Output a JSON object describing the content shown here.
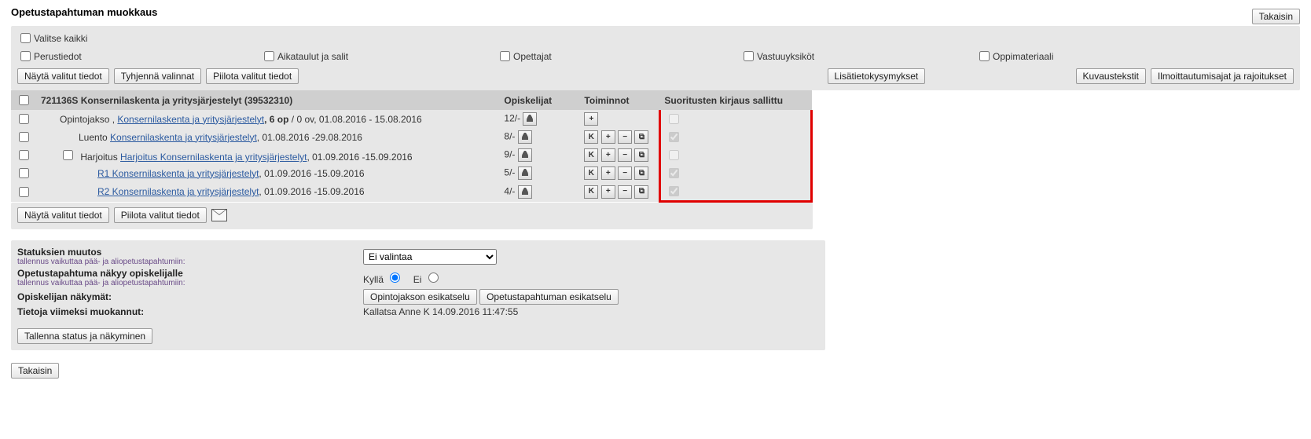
{
  "header": {
    "title": "Opetustapahtuman muokkaus",
    "back_btn": "Takaisin"
  },
  "filter_panel": {
    "select_all": "Valitse kaikki",
    "perustiedot": "Perustiedot",
    "aikataulut": "Aikataulut ja salit",
    "opettajat": "Opettajat",
    "vastuuyksikot": "Vastuuyksiköt",
    "oppimateriaali": "Oppimateriaali",
    "btn_show": "Näytä valitut tiedot",
    "btn_clear": "Tyhjennä valinnat",
    "btn_hide": "Piilota valitut tiedot",
    "btn_lisatieto": "Lisätietokysymykset",
    "btn_kuvaus": "Kuvaustekstit",
    "btn_ilmo": "Ilmoittautumisajat ja rajoitukset"
  },
  "table": {
    "head": {
      "name": "721136S Konsernilaskenta ja yritysjärjestelyt (39532310)",
      "opiskelijat": "Opiskelijat",
      "toiminnot": "Toiminnot",
      "suoritukset": "Suoritusten kirjaus sallittu"
    },
    "rows": [
      {
        "prefix": "Opintojakso , ",
        "link": "Konsernilaskenta ja yritysjärjestelyt",
        "suffix_bold": ", 6 op",
        "suffix": " / 0 ov, 01.08.2016 - 15.08.2016",
        "students": "12/-",
        "actions": "plus",
        "checked": false,
        "disabled": true
      },
      {
        "prefix": "Luento ",
        "link": "Konsernilaskenta ja yritysjärjestelyt",
        "suffix": ", 01.08.2016 -29.08.2016",
        "students": "8/-",
        "actions": "full",
        "checked": true,
        "disabled": true
      },
      {
        "prefix": "Harjoitus ",
        "link": "Harjoitus Konsernilaskenta ja yritysjärjestelyt",
        "suffix": ", 01.09.2016 -15.09.2016",
        "students": "9/-",
        "actions": "full",
        "checked": false,
        "disabled": true
      },
      {
        "prefix": "",
        "link": "R1 Konsernilaskenta ja yritysjärjestelyt",
        "suffix": ", 01.09.2016 -15.09.2016",
        "students": "5/-",
        "actions": "full",
        "checked": true,
        "disabled": true
      },
      {
        "prefix": "",
        "link": "R2 Konsernilaskenta ja yritysjärjestelyt",
        "suffix": ", 01.09.2016 -15.09.2016",
        "students": "4/-",
        "actions": "full",
        "checked": true,
        "disabled": true
      }
    ],
    "btn_show": "Näytä valitut tiedot",
    "btn_hide": "Piilota valitut tiedot"
  },
  "form": {
    "status_label": "Statuksien muutos",
    "status_sub": "tallennus vaikuttaa pää- ja aliopetustapahtumiin:",
    "status_select": "Ei valintaa",
    "visibility_label": "Opetustapahtuma näkyy opiskelijalle",
    "visibility_sub": "tallennus vaikuttaa pää- ja aliopetustapahtumiin:",
    "radio_yes": "Kyllä",
    "radio_no": "Ei",
    "views_label": "Opiskelijan näkymät:",
    "btn_preview_course": "Opintojakson esikatselu",
    "btn_preview_event": "Opetustapahtuman esikatselu",
    "lastedit_label": "Tietoja viimeksi muokannut:",
    "lastedit_value": "Kallatsa Anne K 14.09.2016 11:47:55",
    "btn_save": "Tallenna status ja näkyminen"
  },
  "footer": {
    "back_btn": "Takaisin"
  }
}
